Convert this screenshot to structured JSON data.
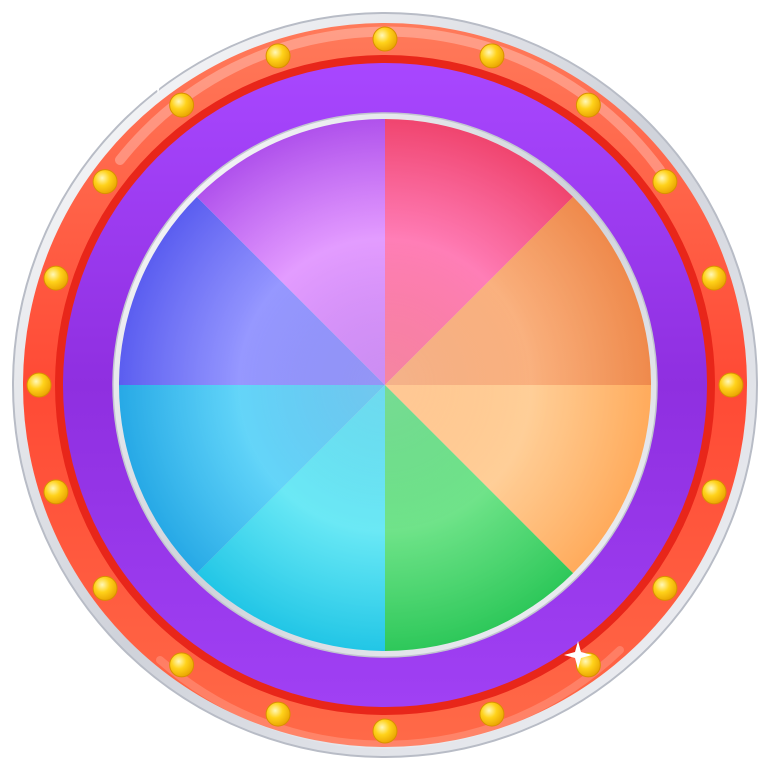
{
  "wheel": {
    "segment_count": 8,
    "segments": [
      {
        "name": "pink",
        "color_a": "#ff6fae",
        "color_b": "#f0456f"
      },
      {
        "name": "orange",
        "color_a": "#f9a870",
        "color_b": "#ef8a4c"
      },
      {
        "name": "peach",
        "color_a": "#ffc98c",
        "color_b": "#ffab5c"
      },
      {
        "name": "green",
        "color_a": "#5fe07c",
        "color_b": "#2ec85a"
      },
      {
        "name": "cyan",
        "color_a": "#5ae6f4",
        "color_b": "#22c6e6"
      },
      {
        "name": "sky-blue",
        "color_a": "#52d0f8",
        "color_b": "#27a9e6"
      },
      {
        "name": "indigo",
        "color_a": "#8a8cff",
        "color_b": "#5b5ef0"
      },
      {
        "name": "violet",
        "color_a": "#e091ff",
        "color_b": "#b052ec"
      }
    ]
  },
  "frame": {
    "outer_rim_color": "#ff5a3d",
    "outer_rim_highlight": "#ff8a6a",
    "silver_color": "#e4e6ec",
    "inner_band_color": "#9c3ae8",
    "inner_band_highlight": "#b45cff",
    "bulb_color": "#ffd21a",
    "bulb_count": 20
  },
  "icons": {
    "sparkle": "sparkle-icon",
    "bulb": "light-bulb-icon"
  }
}
